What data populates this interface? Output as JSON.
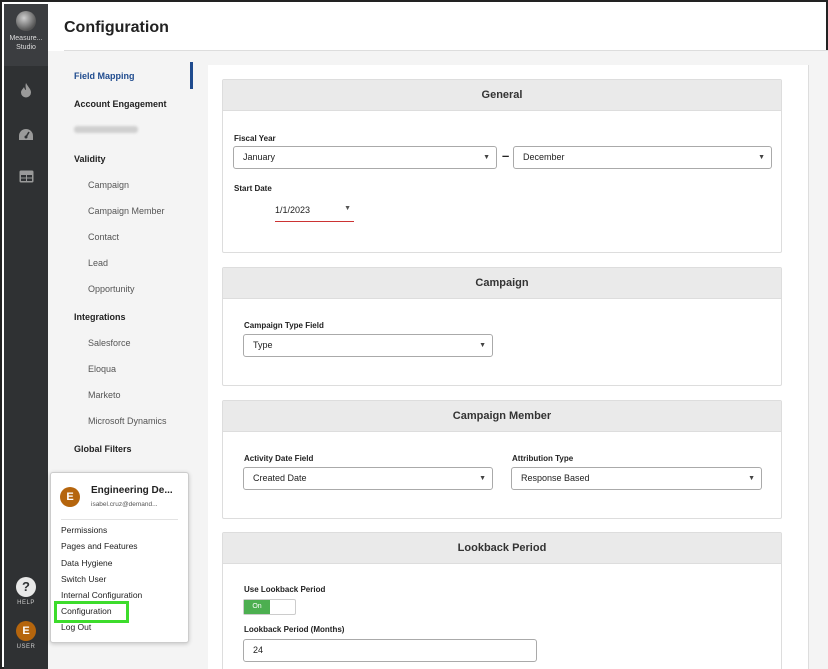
{
  "rail": {
    "logo_label": "Measure... Studio",
    "help_label": "HELP",
    "help_glyph": "?",
    "user_label": "USER",
    "user_initial": "E"
  },
  "header": {
    "title": "Configuration"
  },
  "nav": {
    "field_mapping": "Field Mapping",
    "account_engagement": "Account Engagement",
    "validity": "Validity",
    "validity_items": [
      "Campaign",
      "Campaign Member",
      "Contact",
      "Lead",
      "Opportunity"
    ],
    "integrations": "Integrations",
    "integration_items": [
      "Salesforce",
      "Eloqua",
      "Marketo",
      "Microsoft Dynamics"
    ],
    "global_filters": "Global Filters"
  },
  "general": {
    "title": "General",
    "fiscal_year_label": "Fiscal Year",
    "fiscal_start": "January",
    "fiscal_end": "December",
    "range_separator": "–",
    "start_date_label": "Start Date",
    "start_date": "1/1/2023"
  },
  "campaign": {
    "title": "Campaign",
    "type_field_label": "Campaign Type Field",
    "type_field_value": "Type"
  },
  "campaign_member": {
    "title": "Campaign Member",
    "activity_date_label": "Activity Date Field",
    "activity_date_value": "Created Date",
    "attribution_label": "Attribution Type",
    "attribution_value": "Response Based"
  },
  "lookback": {
    "title": "Lookback Period",
    "use_label": "Use Lookback Period",
    "toggle_text": "On",
    "months_label": "Lookback Period (Months)",
    "months_value": "24"
  },
  "user_menu": {
    "initial": "E",
    "name": "Engineering De...",
    "email": "isabel.cruz@demand...",
    "items": [
      "Permissions",
      "Pages and Features",
      "Data Hygiene",
      "Switch User",
      "Internal Configuration",
      "Configuration",
      "Log Out"
    ]
  },
  "colors": {
    "accent": "#1f4b8e",
    "highlight": "#3ddc2c",
    "avatar": "#b5650d",
    "toggle_on": "#4caf50"
  }
}
